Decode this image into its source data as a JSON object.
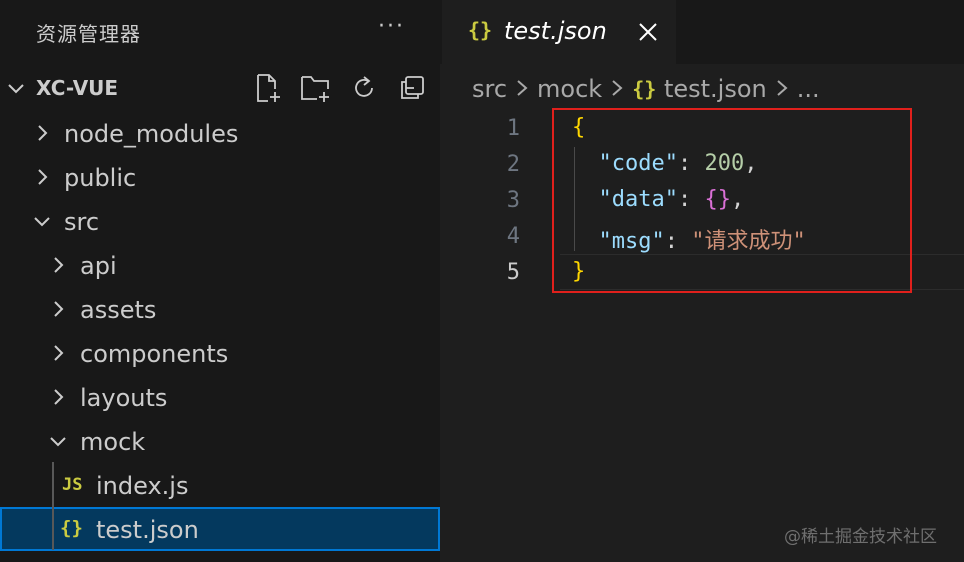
{
  "sidebar": {
    "title": "资源管理器",
    "more": "···",
    "project": "XC-VUE",
    "actions": [
      "new-file-icon",
      "new-folder-icon",
      "refresh-icon",
      "collapse-all-icon"
    ],
    "tree": [
      {
        "label": "node_modules",
        "type": "folder",
        "expanded": false,
        "depth": 0
      },
      {
        "label": "public",
        "type": "folder",
        "expanded": false,
        "depth": 0
      },
      {
        "label": "src",
        "type": "folder",
        "expanded": true,
        "depth": 0
      },
      {
        "label": "api",
        "type": "folder",
        "expanded": false,
        "depth": 1
      },
      {
        "label": "assets",
        "type": "folder",
        "expanded": false,
        "depth": 1
      },
      {
        "label": "components",
        "type": "folder",
        "expanded": false,
        "depth": 1
      },
      {
        "label": "layouts",
        "type": "folder",
        "expanded": false,
        "depth": 1
      },
      {
        "label": "mock",
        "type": "folder",
        "expanded": true,
        "depth": 1
      },
      {
        "label": "index.js",
        "type": "js",
        "depth": 2,
        "icon": "JS"
      },
      {
        "label": "test.json",
        "type": "json",
        "depth": 2,
        "icon": "{}",
        "selected": true
      }
    ]
  },
  "editor": {
    "tab": {
      "icon": "{}",
      "label": "test.json",
      "close": "close-icon"
    },
    "breadcrumb": {
      "parts": [
        "src",
        "mock",
        "test.json",
        "..."
      ],
      "file_icon": "{}"
    },
    "lines": [
      {
        "n": "1",
        "tokens": [
          {
            "t": "{",
            "c": "brace"
          }
        ]
      },
      {
        "n": "2",
        "tokens": [
          {
            "t": "  ",
            "c": "punct"
          },
          {
            "t": "\"code\"",
            "c": "key"
          },
          {
            "t": ": ",
            "c": "punct"
          },
          {
            "t": "200",
            "c": "num"
          },
          {
            "t": ",",
            "c": "punct"
          }
        ]
      },
      {
        "n": "3",
        "tokens": [
          {
            "t": "  ",
            "c": "punct"
          },
          {
            "t": "\"data\"",
            "c": "key"
          },
          {
            "t": ": ",
            "c": "punct"
          },
          {
            "t": "{}",
            "c": "brace2"
          },
          {
            "t": ",",
            "c": "punct"
          }
        ]
      },
      {
        "n": "4",
        "tokens": [
          {
            "t": "  ",
            "c": "punct"
          },
          {
            "t": "\"msg\"",
            "c": "key"
          },
          {
            "t": ": ",
            "c": "punct"
          },
          {
            "t": "\"请求成功\"",
            "c": "str"
          }
        ]
      },
      {
        "n": "5",
        "tokens": [
          {
            "t": "}",
            "c": "brace"
          }
        ],
        "active": true
      }
    ]
  },
  "watermark": "@稀土掘金技术社区",
  "colors": {
    "background": "#1e1e1e",
    "sidebar": "#181818",
    "selection": "#04395e",
    "focus_border": "#0078d4",
    "annotation_box": "#e0201c",
    "json_icon": "#cbcb41"
  }
}
